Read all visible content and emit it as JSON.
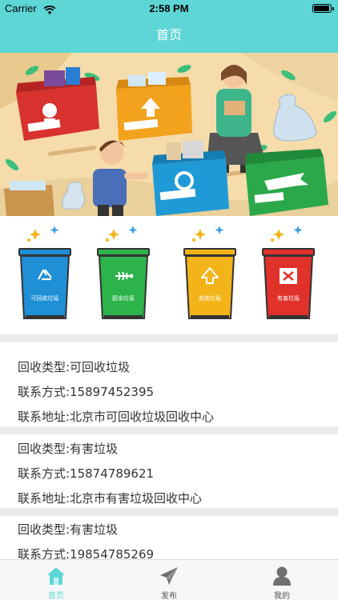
{
  "status_bar": {
    "carrier": "Carrier",
    "time": "2:58 PM"
  },
  "nav": {
    "title": "首页"
  },
  "banner": {
    "icons": [
      "hazardous-waste-bin",
      "other-waste-bin",
      "recyclable-bin",
      "kitchen-waste-bin"
    ]
  },
  "bins": [
    {
      "label": "可回收垃圾",
      "color": "#1f8fd6",
      "icon": "recycle-icon"
    },
    {
      "label": "厨余垃圾",
      "color": "#2cb34a",
      "icon": "fish-bone-icon"
    },
    {
      "label": "其他垃圾",
      "color": "#f2b418",
      "icon": "arrow-up-icon"
    },
    {
      "label": "有害垃圾",
      "color": "#e0312b",
      "icon": "hazard-icon"
    }
  ],
  "records": [
    {
      "type": "回收类型:可回收垃圾",
      "phone": "联系方式:15897452395",
      "address": "联系地址:北京市可回收垃圾回收中心"
    },
    {
      "type": "回收类型:有害垃圾",
      "phone": "联系方式:15874789621",
      "address": "联系地址:北京市有害垃圾回收中心"
    },
    {
      "type": "回收类型:有害垃圾",
      "phone": "联系方式:19854785269",
      "address": ""
    }
  ],
  "tabbar": {
    "active_color": "#5ed6d6",
    "inactive_color": "#555555",
    "items": [
      {
        "label": "首页",
        "icon": "home-icon"
      },
      {
        "label": "发布",
        "icon": "paper-plane-icon"
      },
      {
        "label": "我的",
        "icon": "person-icon"
      }
    ]
  }
}
